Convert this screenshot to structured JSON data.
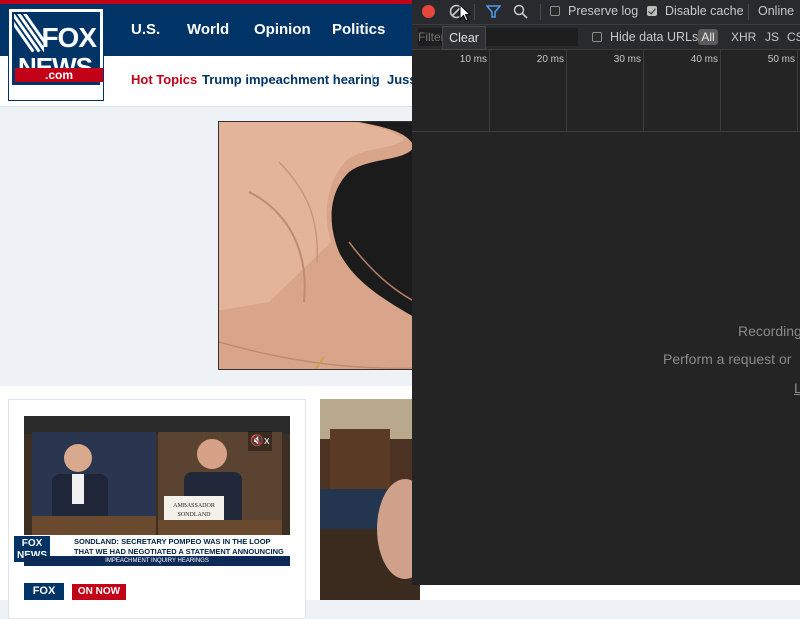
{
  "site": {
    "logo": {
      "word1": "FOX",
      "word2": "NEWS",
      "suffix": ".com"
    },
    "nav": [
      "U.S.",
      "World",
      "Opinion",
      "Politics"
    ],
    "hot_topics": {
      "label": "Hot Topics",
      "links": [
        "Trump impeachment hearing",
        "Juss"
      ]
    },
    "video": {
      "mute_icon_text": "🔇x",
      "chyron_logo": "FOX NEWS",
      "chyron_text": "SONDLAND: SECRETARY POMPEO WAS IN THE LOOP THAT WE HAD NEGOTIATED A STATEMENT ANNOUNCING INVESTIGATIONS",
      "chyron_strip": "IMPEACHMENT INQUIRY  HEARINGS",
      "nameplate": "AMBASSADOR SONDLAND"
    },
    "card_footer": {
      "logo": "FOX",
      "badge": "ON NOW"
    }
  },
  "devtools": {
    "toolbar": {
      "preserve_log": {
        "label": "Preserve log",
        "checked": false
      },
      "disable_cache": {
        "label": "Disable cache",
        "checked": true
      },
      "throttle": "Online"
    },
    "tooltip": "Clear",
    "filter": {
      "placeholder": "Filter"
    },
    "hide_data_urls": {
      "label": "Hide data URLs",
      "checked": false
    },
    "types": [
      "All",
      "XHR",
      "JS",
      "CS"
    ],
    "timeline_ticks": [
      "10 ms",
      "20 ms",
      "30 ms",
      "40 ms",
      "50 ms"
    ],
    "empty_state": {
      "line1": "Recording",
      "line2": "Perform a request or",
      "link": "L"
    }
  }
}
